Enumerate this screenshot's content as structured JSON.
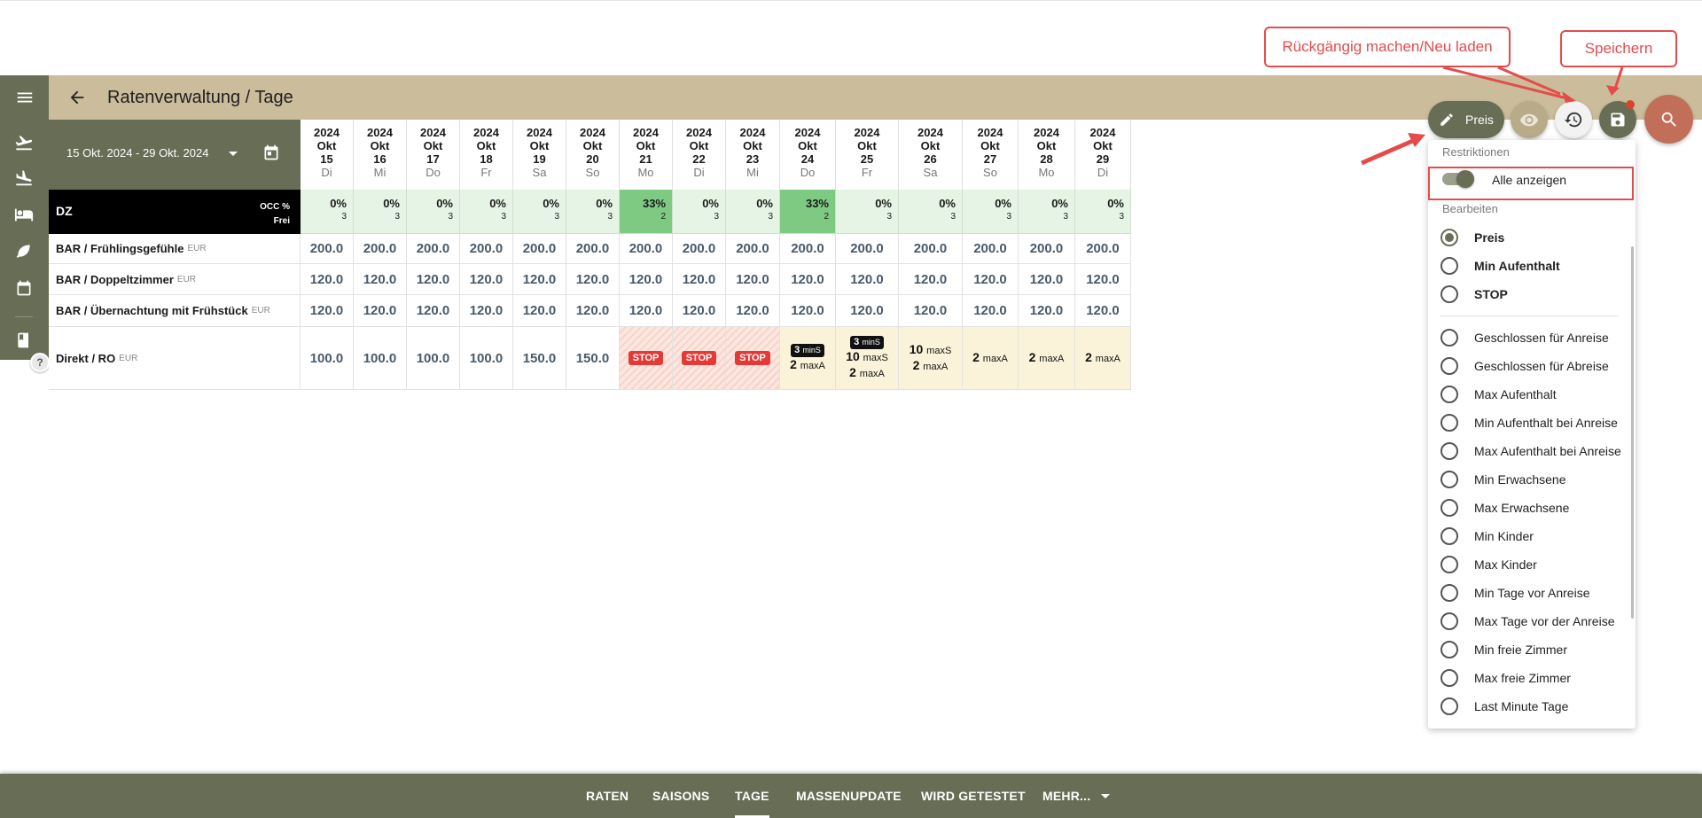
{
  "header": {
    "title": "Ratenverwaltung / Tage"
  },
  "daterange": {
    "label": "15 Okt. 2024 - 29 Okt. 2024"
  },
  "columns": [
    {
      "year": "2024",
      "month": "Okt",
      "day": "15",
      "weekday": "Di"
    },
    {
      "year": "2024",
      "month": "Okt",
      "day": "16",
      "weekday": "Mi"
    },
    {
      "year": "2024",
      "month": "Okt",
      "day": "17",
      "weekday": "Do"
    },
    {
      "year": "2024",
      "month": "Okt",
      "day": "18",
      "weekday": "Fr"
    },
    {
      "year": "2024",
      "month": "Okt",
      "day": "19",
      "weekday": "Sa"
    },
    {
      "year": "2024",
      "month": "Okt",
      "day": "20",
      "weekday": "So"
    },
    {
      "year": "2024",
      "month": "Okt",
      "day": "21",
      "weekday": "Mo"
    },
    {
      "year": "2024",
      "month": "Okt",
      "day": "22",
      "weekday": "Di"
    },
    {
      "year": "2024",
      "month": "Okt",
      "day": "23",
      "weekday": "Mi"
    },
    {
      "year": "2024",
      "month": "Okt",
      "day": "24",
      "weekday": "Do"
    },
    {
      "year": "2024",
      "month": "Okt",
      "day": "25",
      "weekday": "Fr"
    },
    {
      "year": "2024",
      "month": "Okt",
      "day": "26",
      "weekday": "Sa"
    },
    {
      "year": "2024",
      "month": "Okt",
      "day": "27",
      "weekday": "So"
    },
    {
      "year": "2024",
      "month": "Okt",
      "day": "28",
      "weekday": "Mo"
    },
    {
      "year": "2024",
      "month": "Okt",
      "day": "29",
      "weekday": "Di"
    }
  ],
  "room": {
    "name": "DZ",
    "occ_label": "OCC %",
    "free_label": "Frei",
    "occ": [
      {
        "pct": "0%",
        "free": "3"
      },
      {
        "pct": "0%",
        "free": "3"
      },
      {
        "pct": "0%",
        "free": "3"
      },
      {
        "pct": "0%",
        "free": "3"
      },
      {
        "pct": "0%",
        "free": "3"
      },
      {
        "pct": "0%",
        "free": "3"
      },
      {
        "pct": "33%",
        "free": "2"
      },
      {
        "pct": "0%",
        "free": "3"
      },
      {
        "pct": "0%",
        "free": "3"
      },
      {
        "pct": "33%",
        "free": "2"
      },
      {
        "pct": "0%",
        "free": "3"
      },
      {
        "pct": "0%",
        "free": "3"
      },
      {
        "pct": "0%",
        "free": "3"
      },
      {
        "pct": "0%",
        "free": "3"
      },
      {
        "pct": "0%",
        "free": "3"
      }
    ]
  },
  "rates": [
    {
      "name": "BAR / Frühlingsgefühle",
      "currency": "EUR",
      "values": [
        "200.0",
        "200.0",
        "200.0",
        "200.0",
        "200.0",
        "200.0",
        "200.0",
        "200.0",
        "200.0",
        "200.0",
        "200.0",
        "200.0",
        "200.0",
        "200.0",
        "200.0"
      ]
    },
    {
      "name": "BAR / Doppeltzimmer",
      "currency": "EUR",
      "values": [
        "120.0",
        "120.0",
        "120.0",
        "120.0",
        "120.0",
        "120.0",
        "120.0",
        "120.0",
        "120.0",
        "120.0",
        "120.0",
        "120.0",
        "120.0",
        "120.0",
        "120.0"
      ]
    },
    {
      "name": "BAR / Übernachtung mit Frühstück",
      "currency": "EUR",
      "values": [
        "120.0",
        "120.0",
        "120.0",
        "120.0",
        "120.0",
        "120.0",
        "120.0",
        "120.0",
        "120.0",
        "120.0",
        "120.0",
        "120.0",
        "120.0",
        "120.0",
        "120.0"
      ]
    }
  ],
  "direct": {
    "name": "Direkt / RO",
    "currency": "EUR",
    "prices": [
      "100.0",
      "100.0",
      "100.0",
      "100.0",
      "150.0",
      "150.0"
    ],
    "stop_label": "STOP",
    "restrictions": {
      "d24": {
        "badge_num": "3",
        "badge_unit": "minS",
        "line_num": "2",
        "line_unit": "maxA"
      },
      "d25": {
        "badge_num": "3",
        "badge_unit": "minS",
        "line1_num": "10",
        "line1_unit": "maxS",
        "line2_num": "2",
        "line2_unit": "maxA"
      },
      "d26": {
        "line1_num": "10",
        "line1_unit": "maxS",
        "line2_num": "2",
        "line2_unit": "maxA"
      },
      "d27": {
        "num": "2",
        "unit": "maxA"
      },
      "d28": {
        "num": "2",
        "unit": "maxA"
      },
      "d29": {
        "num": "2",
        "unit": "maxA"
      }
    }
  },
  "toolbar": {
    "edit_label": "Preis"
  },
  "callouts": {
    "undo": "Rückgängig machen/Neu laden",
    "save": "Speichern"
  },
  "panel": {
    "section_restrictions": "Restriktionen",
    "toggle_label": "Alle anzeigen",
    "section_edit": "Bearbeiten",
    "primary": [
      "Preis",
      "Min Aufenthalt",
      "STOP"
    ],
    "others": [
      "Geschlossen für Anreise",
      "Geschlossen für Abreise",
      "Max Aufenthalt",
      "Min Aufenthalt bei Anreise",
      "Max Aufenthalt bei Anreise",
      "Min Erwachsene",
      "Max Erwachsene",
      "Min Kinder",
      "Max Kinder",
      "Min Tage vor Anreise",
      "Max Tage vor der Anreise",
      "Min freie Zimmer",
      "Max freie Zimmer",
      "Last Minute Tage"
    ]
  },
  "tabs": [
    "RATEN",
    "SAISONS",
    "TAGE",
    "MASSENUPDATE",
    "WIRD GETESTET",
    "MEHR..."
  ],
  "colors": {
    "olive": "#676e55",
    "sand": "#cbbd9b",
    "accent_red": "#e44c4c",
    "search_fab": "#c26f5a"
  },
  "icons": [
    "menu-icon",
    "arrow-back-icon",
    "flight-takeoff-icon",
    "flight-land-icon",
    "bed-icon",
    "leaf-icon",
    "calendar-icon",
    "book-icon",
    "help-icon",
    "pencil-icon",
    "eye-icon",
    "restore-icon",
    "save-icon",
    "search-icon",
    "chevron-down-icon"
  ]
}
